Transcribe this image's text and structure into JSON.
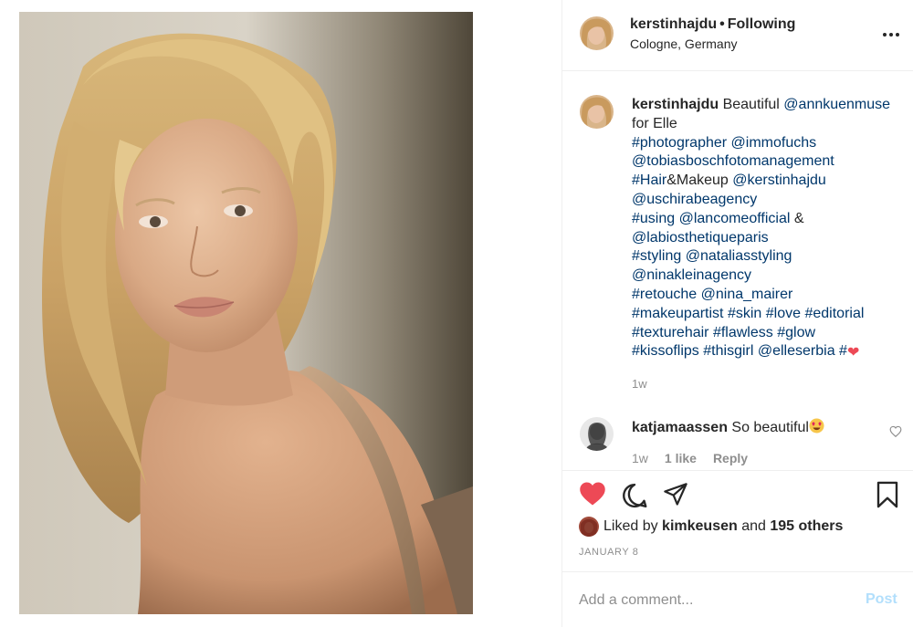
{
  "post": {
    "username": "kerstinhajdu",
    "dot": "•",
    "follow_status": "Following",
    "location": "Cologne, Germany"
  },
  "caption": {
    "username": "kerstinhajdu",
    "lines": [
      [
        {
          "t": " Beautiful ",
          "k": "text"
        },
        {
          "t": "@annkuenmuse",
          "k": "tag"
        }
      ],
      [
        {
          "t": "for Elle",
          "k": "text"
        }
      ],
      [
        {
          "t": "#photographer",
          "k": "tag"
        },
        {
          "t": " ",
          "k": "text"
        },
        {
          "t": "@immofuchs",
          "k": "tag"
        }
      ],
      [
        {
          "t": "@tobiasboschfotomanagement",
          "k": "tag"
        }
      ],
      [
        {
          "t": "#Hair",
          "k": "tag"
        },
        {
          "t": "&Makeup ",
          "k": "text"
        },
        {
          "t": "@kerstinhajdu",
          "k": "tag"
        }
      ],
      [
        {
          "t": "@uschirabeagency",
          "k": "tag"
        }
      ],
      [
        {
          "t": "#using",
          "k": "tag"
        },
        {
          "t": " ",
          "k": "text"
        },
        {
          "t": "@lancomeofficial",
          "k": "tag"
        },
        {
          "t": " &",
          "k": "text"
        }
      ],
      [
        {
          "t": "@labiosthetiqueparis",
          "k": "tag"
        }
      ],
      [
        {
          "t": "#styling",
          "k": "tag"
        },
        {
          "t": " ",
          "k": "text"
        },
        {
          "t": "@nataliasstyling",
          "k": "tag"
        }
      ],
      [
        {
          "t": "@ninakleinagency",
          "k": "tag"
        }
      ],
      [
        {
          "t": "#retouche",
          "k": "tag"
        },
        {
          "t": " ",
          "k": "text"
        },
        {
          "t": "@nina_mairer",
          "k": "tag"
        }
      ],
      [
        {
          "t": "#makeupartist",
          "k": "tag"
        },
        {
          "t": " ",
          "k": "text"
        },
        {
          "t": "#skin",
          "k": "tag"
        },
        {
          "t": " ",
          "k": "text"
        },
        {
          "t": "#love",
          "k": "tag"
        },
        {
          "t": " ",
          "k": "text"
        },
        {
          "t": "#editorial",
          "k": "tag"
        }
      ],
      [
        {
          "t": "#texturehair",
          "k": "tag"
        },
        {
          "t": " ",
          "k": "text"
        },
        {
          "t": "#flawless",
          "k": "tag"
        },
        {
          "t": " ",
          "k": "text"
        },
        {
          "t": "#glow",
          "k": "tag"
        }
      ],
      [
        {
          "t": "#kissoflips",
          "k": "tag"
        },
        {
          "t": " ",
          "k": "text"
        },
        {
          "t": "#thisgirl",
          "k": "tag"
        },
        {
          "t": " ",
          "k": "text"
        },
        {
          "t": "@elleserbia",
          "k": "tag"
        },
        {
          "t": " ",
          "k": "text"
        },
        {
          "t": "#",
          "k": "tag"
        },
        {
          "t": "❤",
          "k": "heart"
        }
      ]
    ],
    "time": "1w"
  },
  "comment": {
    "username": "katjamaassen",
    "text": " So beautiful",
    "emoji": "heart-eyes-emoji",
    "time": "1w",
    "likes": "1 like",
    "reply": "Reply"
  },
  "actions": {
    "liked_by_prefix": "Liked by ",
    "liked_by_user": "kimkeusen",
    "liked_by_and": " and ",
    "liked_by_others": "195 others",
    "date": "JANUARY 8"
  },
  "comment_box": {
    "placeholder": "Add a comment...",
    "post_label": "Post"
  },
  "colors": {
    "like_red": "#ed4956",
    "tag_blue": "#00376b",
    "post_disabled": "#b2dffc",
    "muted": "#8e8e8e"
  },
  "icons": [
    "more-icon",
    "heart-icon",
    "comment-icon",
    "share-icon",
    "bookmark-icon",
    "small-heart-icon"
  ]
}
